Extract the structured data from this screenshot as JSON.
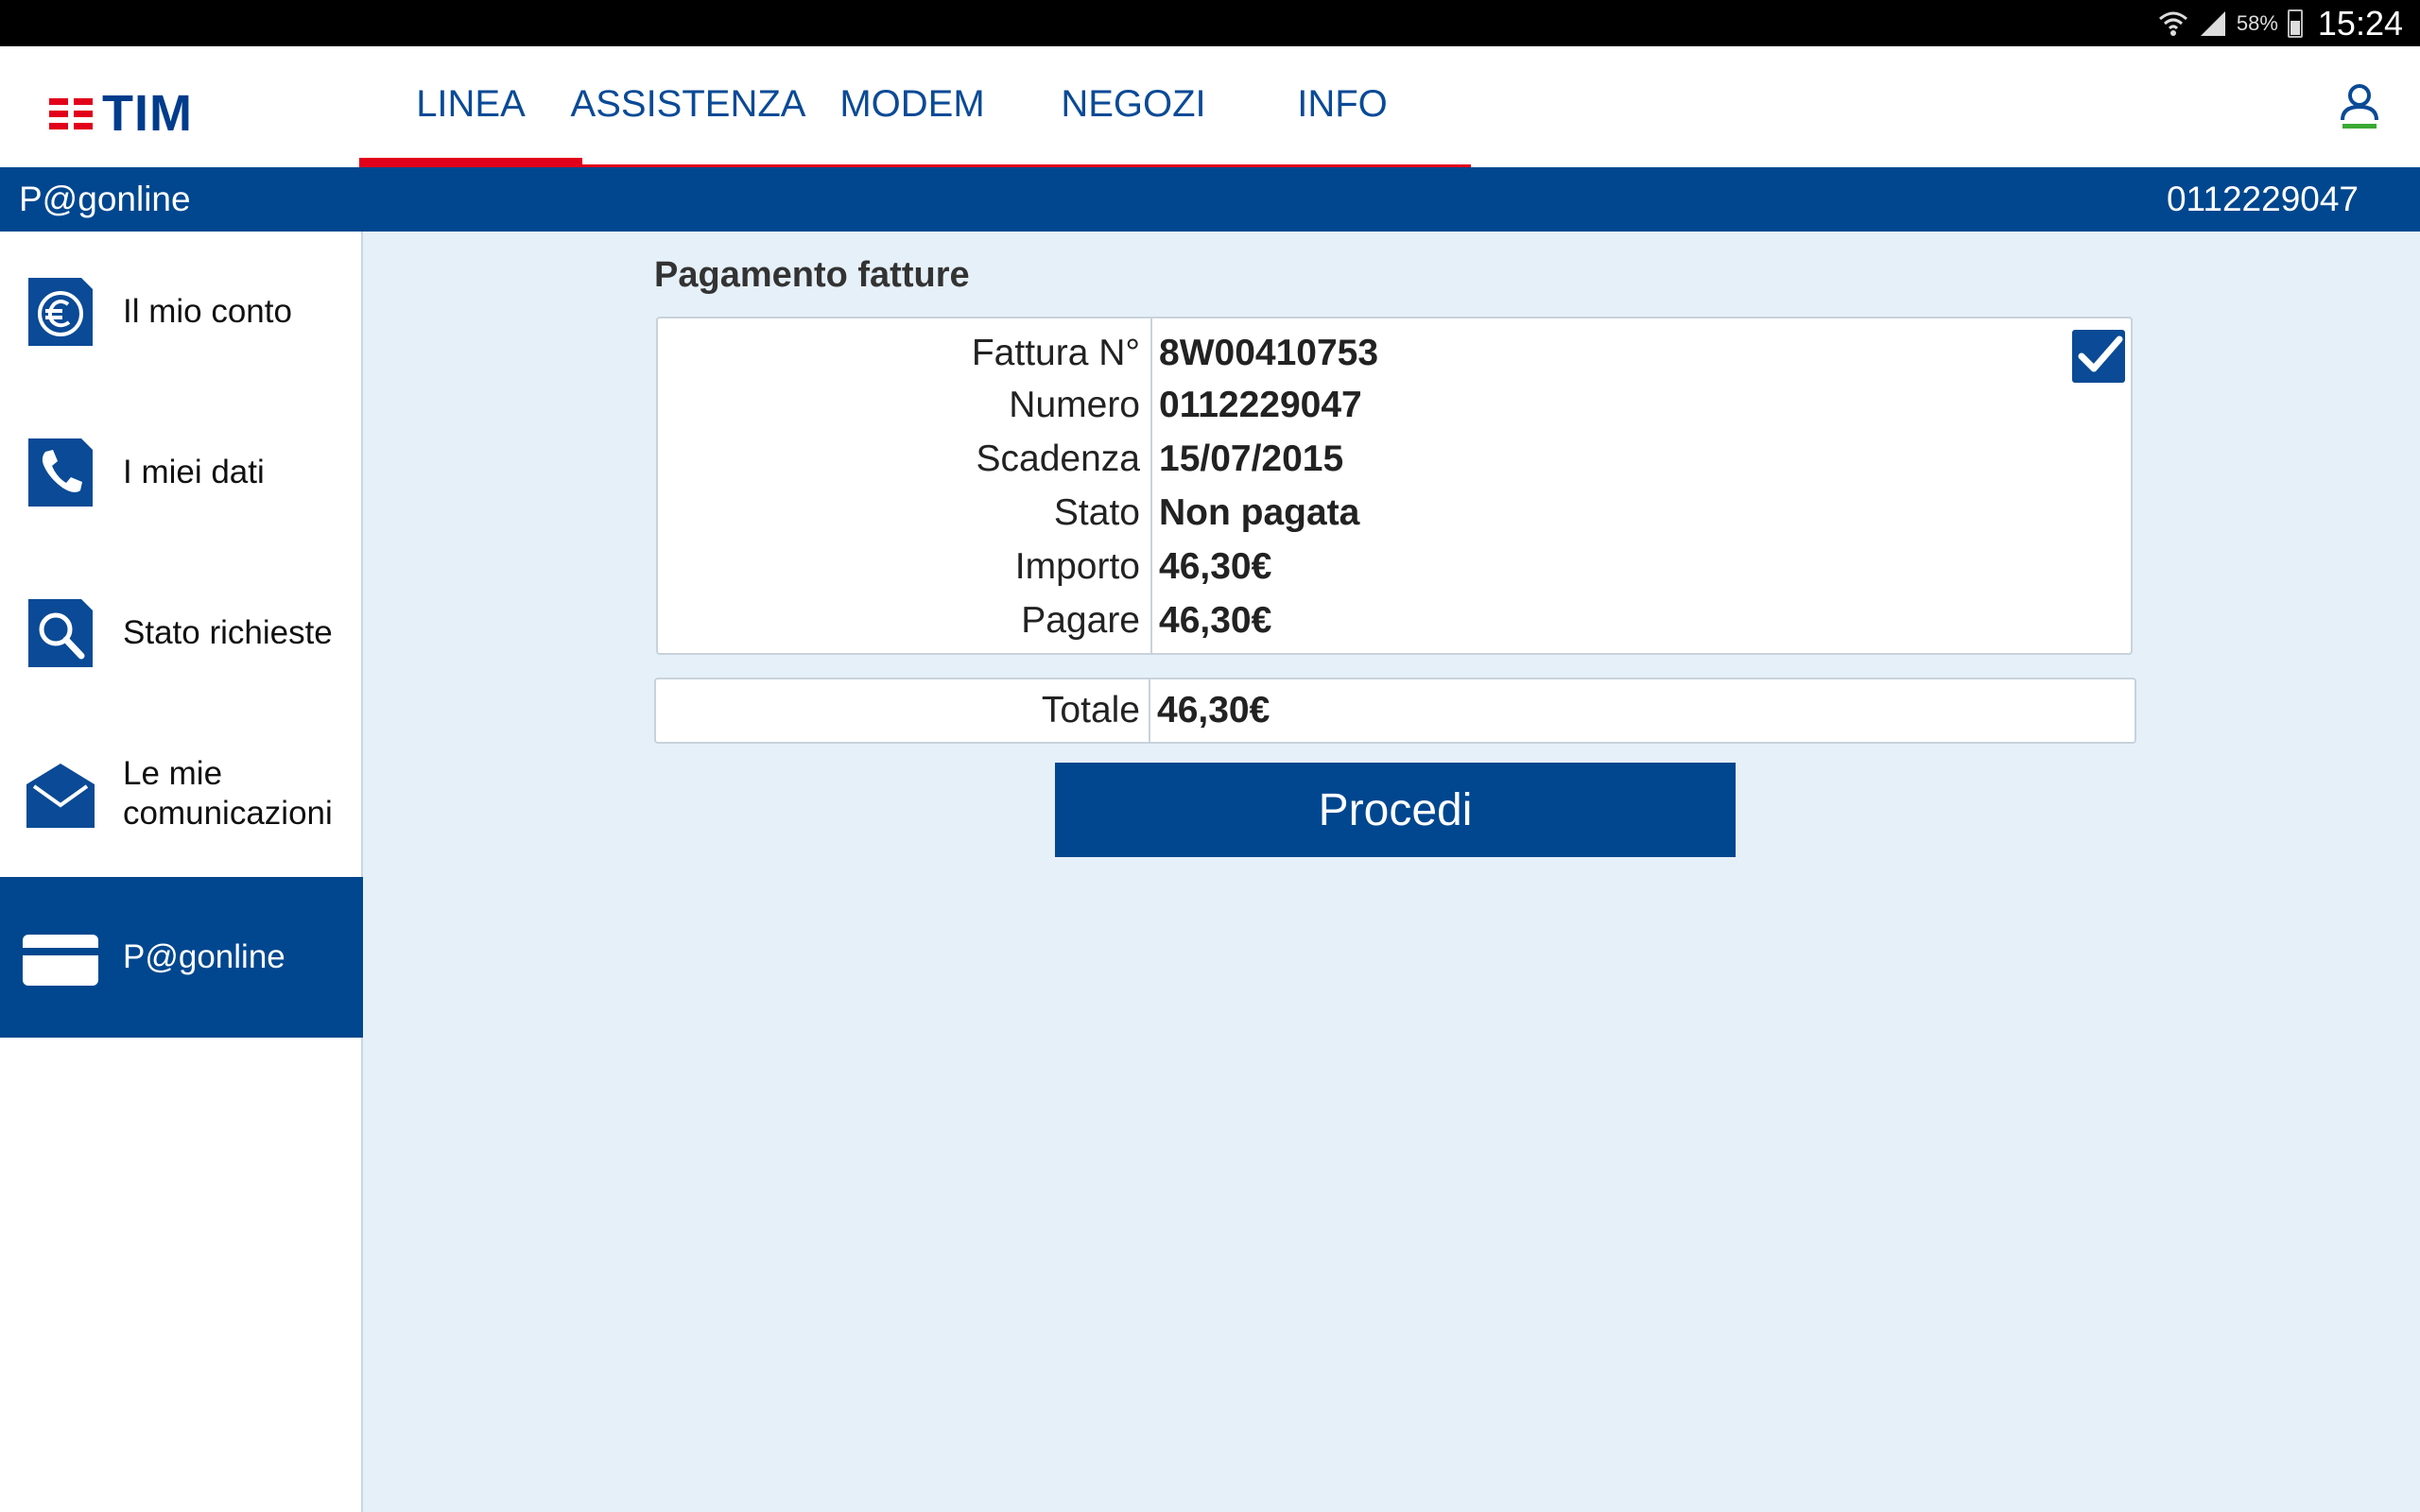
{
  "status_bar": {
    "battery": "58%",
    "time": "15:24",
    "icons": [
      "wifi-icon",
      "signal-icon",
      "battery-icon"
    ]
  },
  "brand": {
    "logo_text": "TIM",
    "accent": "#e2001a",
    "primary": "#00478f"
  },
  "nav": {
    "tabs": [
      {
        "label": "LINEA",
        "active": true
      },
      {
        "label": "ASSISTENZA",
        "active": false
      },
      {
        "label": "MODEM",
        "active": false
      },
      {
        "label": "NEGOZI",
        "active": false
      },
      {
        "label": "INFO",
        "active": false
      }
    ]
  },
  "subheader": {
    "title": "P@gonline",
    "phone_number": "0112229047"
  },
  "sidebar": {
    "items": [
      {
        "label": "Il mio conto",
        "icon": "euro-icon",
        "active": false
      },
      {
        "label": "I miei dati",
        "icon": "phone-icon",
        "active": false
      },
      {
        "label": "Stato richieste",
        "icon": "search-icon",
        "active": false
      },
      {
        "label": "Le mie comunicazioni",
        "icon": "envelope-icon",
        "active": false
      },
      {
        "label": "P@gonline",
        "icon": "credit-card-icon",
        "active": true
      }
    ]
  },
  "content": {
    "title": "Pagamento fatture",
    "invoice": {
      "selected": true,
      "rows": [
        {
          "key": "Fattura N°",
          "value": "8W00410753"
        },
        {
          "key": "Numero",
          "value": "0112229047"
        },
        {
          "key": "Scadenza",
          "value": "15/07/2015"
        },
        {
          "key": "Stato",
          "value": "Non pagata"
        },
        {
          "key": "Importo",
          "value": "46,30€"
        },
        {
          "key": "Pagare",
          "value": "46,30€"
        }
      ]
    },
    "total": {
      "key": "Totale",
      "value": "46,30€"
    },
    "proceed_label": "Procedi"
  }
}
